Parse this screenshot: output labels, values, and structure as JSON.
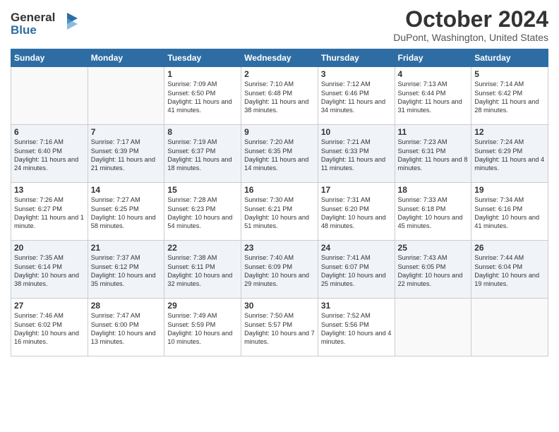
{
  "header": {
    "logo_line1": "General",
    "logo_line2": "Blue",
    "month_title": "October 2024",
    "location": "DuPont, Washington, United States"
  },
  "weekdays": [
    "Sunday",
    "Monday",
    "Tuesday",
    "Wednesday",
    "Thursday",
    "Friday",
    "Saturday"
  ],
  "weeks": [
    [
      {
        "day": "",
        "info": ""
      },
      {
        "day": "",
        "info": ""
      },
      {
        "day": "1",
        "info": "Sunrise: 7:09 AM\nSunset: 6:50 PM\nDaylight: 11 hours and 41 minutes."
      },
      {
        "day": "2",
        "info": "Sunrise: 7:10 AM\nSunset: 6:48 PM\nDaylight: 11 hours and 38 minutes."
      },
      {
        "day": "3",
        "info": "Sunrise: 7:12 AM\nSunset: 6:46 PM\nDaylight: 11 hours and 34 minutes."
      },
      {
        "day": "4",
        "info": "Sunrise: 7:13 AM\nSunset: 6:44 PM\nDaylight: 11 hours and 31 minutes."
      },
      {
        "day": "5",
        "info": "Sunrise: 7:14 AM\nSunset: 6:42 PM\nDaylight: 11 hours and 28 minutes."
      }
    ],
    [
      {
        "day": "6",
        "info": "Sunrise: 7:16 AM\nSunset: 6:40 PM\nDaylight: 11 hours and 24 minutes."
      },
      {
        "day": "7",
        "info": "Sunrise: 7:17 AM\nSunset: 6:39 PM\nDaylight: 11 hours and 21 minutes."
      },
      {
        "day": "8",
        "info": "Sunrise: 7:19 AM\nSunset: 6:37 PM\nDaylight: 11 hours and 18 minutes."
      },
      {
        "day": "9",
        "info": "Sunrise: 7:20 AM\nSunset: 6:35 PM\nDaylight: 11 hours and 14 minutes."
      },
      {
        "day": "10",
        "info": "Sunrise: 7:21 AM\nSunset: 6:33 PM\nDaylight: 11 hours and 11 minutes."
      },
      {
        "day": "11",
        "info": "Sunrise: 7:23 AM\nSunset: 6:31 PM\nDaylight: 11 hours and 8 minutes."
      },
      {
        "day": "12",
        "info": "Sunrise: 7:24 AM\nSunset: 6:29 PM\nDaylight: 11 hours and 4 minutes."
      }
    ],
    [
      {
        "day": "13",
        "info": "Sunrise: 7:26 AM\nSunset: 6:27 PM\nDaylight: 11 hours and 1 minute."
      },
      {
        "day": "14",
        "info": "Sunrise: 7:27 AM\nSunset: 6:25 PM\nDaylight: 10 hours and 58 minutes."
      },
      {
        "day": "15",
        "info": "Sunrise: 7:28 AM\nSunset: 6:23 PM\nDaylight: 10 hours and 54 minutes."
      },
      {
        "day": "16",
        "info": "Sunrise: 7:30 AM\nSunset: 6:21 PM\nDaylight: 10 hours and 51 minutes."
      },
      {
        "day": "17",
        "info": "Sunrise: 7:31 AM\nSunset: 6:20 PM\nDaylight: 10 hours and 48 minutes."
      },
      {
        "day": "18",
        "info": "Sunrise: 7:33 AM\nSunset: 6:18 PM\nDaylight: 10 hours and 45 minutes."
      },
      {
        "day": "19",
        "info": "Sunrise: 7:34 AM\nSunset: 6:16 PM\nDaylight: 10 hours and 41 minutes."
      }
    ],
    [
      {
        "day": "20",
        "info": "Sunrise: 7:35 AM\nSunset: 6:14 PM\nDaylight: 10 hours and 38 minutes."
      },
      {
        "day": "21",
        "info": "Sunrise: 7:37 AM\nSunset: 6:12 PM\nDaylight: 10 hours and 35 minutes."
      },
      {
        "day": "22",
        "info": "Sunrise: 7:38 AM\nSunset: 6:11 PM\nDaylight: 10 hours and 32 minutes."
      },
      {
        "day": "23",
        "info": "Sunrise: 7:40 AM\nSunset: 6:09 PM\nDaylight: 10 hours and 29 minutes."
      },
      {
        "day": "24",
        "info": "Sunrise: 7:41 AM\nSunset: 6:07 PM\nDaylight: 10 hours and 25 minutes."
      },
      {
        "day": "25",
        "info": "Sunrise: 7:43 AM\nSunset: 6:05 PM\nDaylight: 10 hours and 22 minutes."
      },
      {
        "day": "26",
        "info": "Sunrise: 7:44 AM\nSunset: 6:04 PM\nDaylight: 10 hours and 19 minutes."
      }
    ],
    [
      {
        "day": "27",
        "info": "Sunrise: 7:46 AM\nSunset: 6:02 PM\nDaylight: 10 hours and 16 minutes."
      },
      {
        "day": "28",
        "info": "Sunrise: 7:47 AM\nSunset: 6:00 PM\nDaylight: 10 hours and 13 minutes."
      },
      {
        "day": "29",
        "info": "Sunrise: 7:49 AM\nSunset: 5:59 PM\nDaylight: 10 hours and 10 minutes."
      },
      {
        "day": "30",
        "info": "Sunrise: 7:50 AM\nSunset: 5:57 PM\nDaylight: 10 hours and 7 minutes."
      },
      {
        "day": "31",
        "info": "Sunrise: 7:52 AM\nSunset: 5:56 PM\nDaylight: 10 hours and 4 minutes."
      },
      {
        "day": "",
        "info": ""
      },
      {
        "day": "",
        "info": ""
      }
    ]
  ]
}
